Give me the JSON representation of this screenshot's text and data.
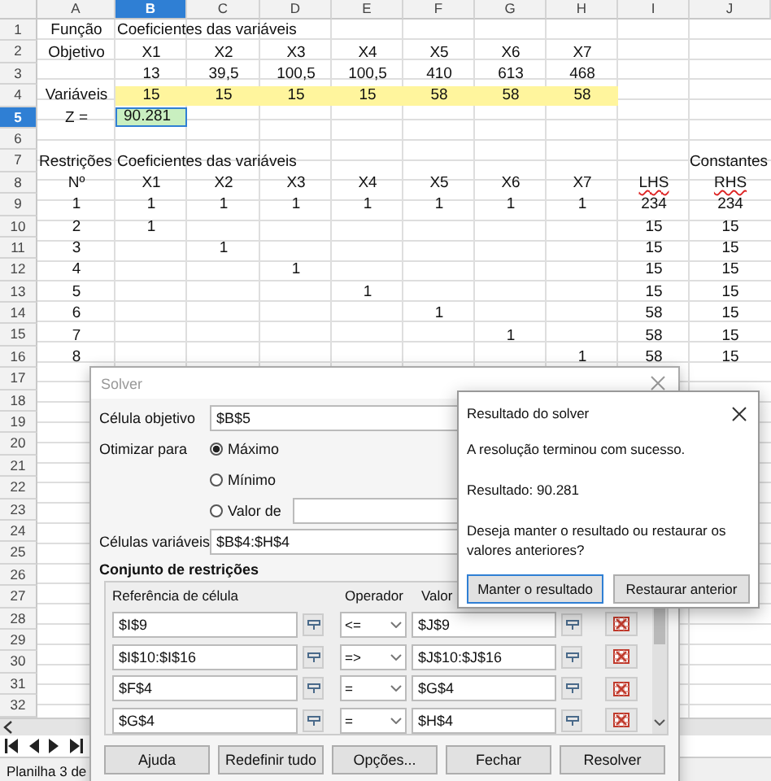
{
  "sheet": {
    "columns": [
      {
        "label": "A",
        "selected": false
      },
      {
        "label": "B",
        "selected": true
      },
      {
        "label": "C",
        "selected": false
      },
      {
        "label": "D",
        "selected": false
      },
      {
        "label": "E",
        "selected": false
      },
      {
        "label": "F",
        "selected": false
      },
      {
        "label": "G",
        "selected": false
      },
      {
        "label": "H",
        "selected": false
      },
      {
        "label": "I",
        "selected": false
      },
      {
        "label": "J",
        "selected": false
      }
    ],
    "rows": [
      {
        "number": "1",
        "selected": false,
        "cells": [
          "Função",
          {
            "text": "Coeficientes das variáveis",
            "kind": "overflow"
          }
        ]
      },
      {
        "number": "2",
        "selected": false,
        "cells": [
          "Objetivo",
          "X1",
          "X2",
          "X3",
          "X4",
          "X5",
          "X6",
          "X7"
        ]
      },
      {
        "number": "3",
        "selected": false,
        "cells": [
          null,
          "13",
          "39,5",
          "100,5",
          "100,5",
          "410",
          "613",
          "468"
        ]
      },
      {
        "number": "4",
        "selected": false,
        "cells": [
          "Variáveis",
          {
            "text": "15",
            "kind": "highlight"
          },
          {
            "text": "15",
            "kind": "highlight"
          },
          {
            "text": "15",
            "kind": "highlight"
          },
          {
            "text": "15",
            "kind": "highlight"
          },
          {
            "text": "58",
            "kind": "highlight"
          },
          {
            "text": "58",
            "kind": "highlight"
          },
          {
            "text": "58",
            "kind": "highlight"
          }
        ]
      },
      {
        "number": "5",
        "selected": true,
        "cells": [
          "Z =",
          {
            "text": "90.281",
            "kind": "active"
          }
        ]
      },
      {
        "number": "6",
        "selected": false,
        "cells": []
      },
      {
        "number": "7",
        "selected": false,
        "cells": [
          {
            "text": "Restrições",
            "kind": "overflow"
          },
          {
            "text": "Coeficientes das variáveis",
            "kind": "overflow"
          },
          null,
          null,
          null,
          null,
          null,
          null,
          null,
          {
            "text": "Constantes",
            "kind": "overflow"
          }
        ]
      },
      {
        "number": "8",
        "selected": false,
        "cells": [
          "Nº",
          "X1",
          "X2",
          "X3",
          "X4",
          "X5",
          "X6",
          "X7",
          {
            "text": "LHS",
            "kind": "misspelled"
          },
          {
            "text": "RHS",
            "kind": "misspelled"
          }
        ]
      },
      {
        "number": "9",
        "selected": false,
        "cells": [
          "1",
          "1",
          "1",
          "1",
          "1",
          "1",
          "1",
          "1",
          "234",
          "234"
        ]
      },
      {
        "number": "10",
        "selected": false,
        "cells": [
          "2",
          "1",
          null,
          null,
          null,
          null,
          null,
          null,
          "15",
          "15"
        ]
      },
      {
        "number": "11",
        "selected": false,
        "cells": [
          "3",
          null,
          "1",
          null,
          null,
          null,
          null,
          null,
          "15",
          "15"
        ]
      },
      {
        "number": "12",
        "selected": false,
        "cells": [
          "4",
          null,
          null,
          "1",
          null,
          null,
          null,
          null,
          "15",
          "15"
        ]
      },
      {
        "number": "13",
        "selected": false,
        "cells": [
          "5",
          null,
          null,
          null,
          "1",
          null,
          null,
          null,
          "15",
          "15"
        ]
      },
      {
        "number": "14",
        "selected": false,
        "cells": [
          "6",
          null,
          null,
          null,
          null,
          "1",
          null,
          null,
          "58",
          "15"
        ]
      },
      {
        "number": "15",
        "selected": false,
        "cells": [
          "7",
          null,
          null,
          null,
          null,
          null,
          "1",
          null,
          "58",
          "15"
        ]
      },
      {
        "number": "16",
        "selected": false,
        "cells": [
          "8",
          null,
          null,
          null,
          null,
          null,
          null,
          "1",
          "58",
          "15"
        ]
      },
      {
        "number": "17",
        "selected": false
      },
      {
        "number": "18",
        "selected": false
      },
      {
        "number": "19",
        "selected": false
      },
      {
        "number": "20",
        "selected": false
      },
      {
        "number": "21",
        "selected": false
      },
      {
        "number": "22",
        "selected": false
      },
      {
        "number": "23",
        "selected": false
      },
      {
        "number": "24",
        "selected": false
      },
      {
        "number": "25",
        "selected": false
      },
      {
        "number": "26",
        "selected": false
      },
      {
        "number": "27",
        "selected": false
      },
      {
        "number": "28",
        "selected": false
      },
      {
        "number": "29",
        "selected": false
      },
      {
        "number": "30",
        "selected": false
      },
      {
        "number": "31",
        "selected": false
      },
      {
        "number": "32",
        "selected": false
      }
    ]
  },
  "status_bar": {
    "text": "Planilha 3 de"
  },
  "solver": {
    "title": "Solver",
    "objective_label": "Célula objetivo",
    "objective_value": "$B$5",
    "optimize_label": "Otimizar para",
    "options": [
      {
        "label": "Máximo",
        "selected": true
      },
      {
        "label": "Mínimo",
        "selected": false
      },
      {
        "label": "Valor de",
        "selected": false
      }
    ],
    "variable_label": "Células variáveis",
    "variable_value": "$B$4:$H$4",
    "constraints_title": "Conjunto de restrições",
    "columns": [
      "Referência de célula",
      "Operador",
      "Valor"
    ],
    "constraints": [
      {
        "reference": "$I$9",
        "operator": "<=",
        "value": "$J$9"
      },
      {
        "reference": "$I$10:$I$16",
        "operator": "=>",
        "value": "$J$10:$J$16"
      },
      {
        "reference": "$F$4",
        "operator": "=",
        "value": "$G$4"
      },
      {
        "reference": "$G$4",
        "operator": "=",
        "value": "$H$4"
      }
    ],
    "buttons": [
      "Ajuda",
      "Redefinir tudo",
      "Opções...",
      "Fechar",
      "Resolver"
    ]
  },
  "result": {
    "title": "Resultado do solver",
    "messages": [
      "A resolução terminou com sucesso.",
      "Resultado: 90.281",
      "Deseja manter o resultado ou restaurar os valores anteriores?"
    ],
    "buttons": [
      {
        "label": "Manter o resultado",
        "default": true
      },
      {
        "label": "Restaurar anterior",
        "default": false
      }
    ]
  }
}
